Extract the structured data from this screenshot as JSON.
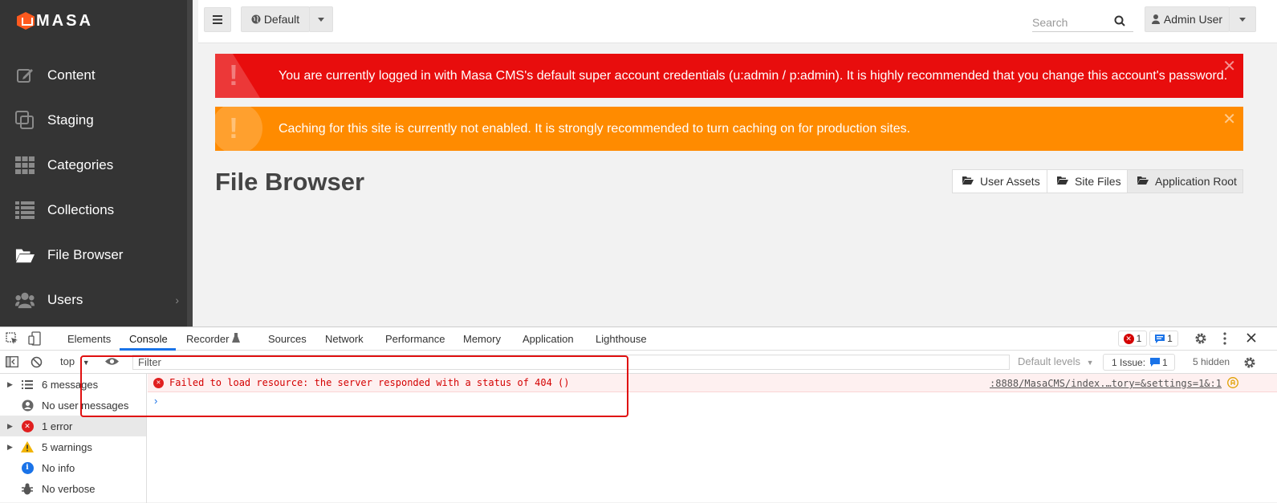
{
  "sidebar": {
    "logo_text": "MASA",
    "items": [
      {
        "label": "Content",
        "icon": "edit-icon"
      },
      {
        "label": "Staging",
        "icon": "copy-icon"
      },
      {
        "label": "Categories",
        "icon": "grid-icon"
      },
      {
        "label": "Collections",
        "icon": "list-icon"
      },
      {
        "label": "File Browser",
        "icon": "folder-open-icon"
      },
      {
        "label": "Users",
        "icon": "users-icon"
      }
    ]
  },
  "topbar": {
    "site_label": "Default",
    "search_placeholder": "Search",
    "user_label": "Admin User"
  },
  "alerts": {
    "credentials": "You are currently logged in with Masa CMS's default super account credentials (u:admin / p:admin). It is highly recommended that you change this account's password.",
    "caching": "Caching for this site is currently not enabled. It is strongly recommended to turn caching on for production sites."
  },
  "main": {
    "title": "File Browser",
    "segments": [
      "User Assets",
      "Site Files",
      "Application Root"
    ]
  },
  "devtools": {
    "tabs": [
      "Elements",
      "Console",
      "Recorder",
      "Sources",
      "Network",
      "Performance",
      "Memory",
      "Application",
      "Lighthouse"
    ],
    "error_count": "1",
    "message_count": "1",
    "context": "top",
    "filter_placeholder": "Filter",
    "levels": "Default levels",
    "issues_label": "1 Issue:",
    "issues_count": "1",
    "hidden": "5 hidden",
    "sidebar": [
      "6 messages",
      "No user messages",
      "1 error",
      "5 warnings",
      "No info",
      "No verbose"
    ],
    "error_text": "Failed to load resource: the server responded with a status of 404 ()",
    "error_source": ":8888/MasaCMS/index.…tory=&settings=1&:1"
  },
  "colors": {
    "sidebar_bg": "#343434",
    "alert_red": "#e80d0d",
    "alert_orange": "#ff8b00",
    "console_error": "#d40000",
    "devtools_accent": "#1a73e8"
  }
}
